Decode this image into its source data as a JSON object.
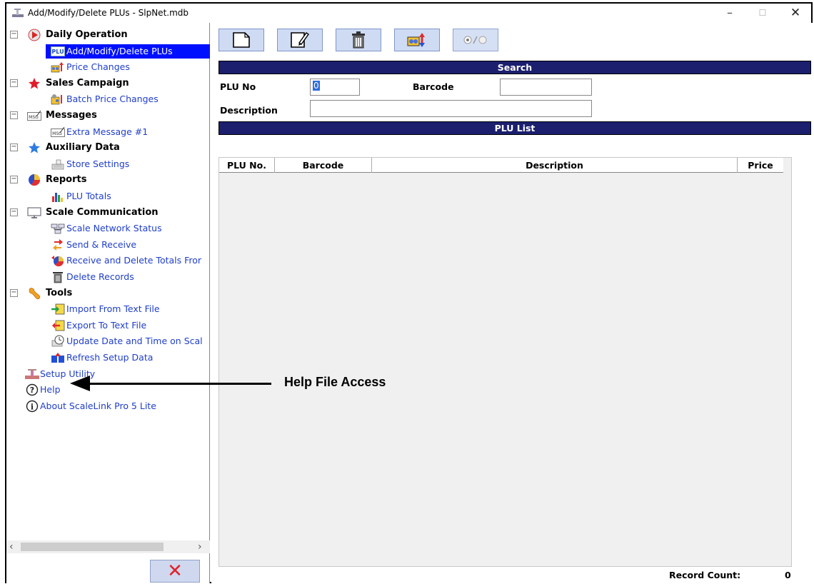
{
  "window": {
    "title": "Add/Modify/Delete PLUs - SlpNet.mdb",
    "min": "–",
    "max": "☐",
    "close": "✕"
  },
  "tree": [
    {
      "kind": "cat",
      "label": "Daily Operation",
      "icon": "play-circle-icon"
    },
    {
      "kind": "item",
      "label": "Add/Modify/Delete PLUs",
      "icon": "plu-icon",
      "selected": true
    },
    {
      "kind": "item",
      "label": "Price Changes",
      "icon": "price-change-icon"
    },
    {
      "kind": "cat",
      "label": "Sales Campaign",
      "icon": "star-red-icon"
    },
    {
      "kind": "item",
      "label": "Batch Price Changes",
      "icon": "batch-price-icon"
    },
    {
      "kind": "cat",
      "label": "Messages",
      "icon": "message-icon"
    },
    {
      "kind": "item",
      "label": "Extra Message #1",
      "icon": "message-icon"
    },
    {
      "kind": "cat",
      "label": "Auxiliary Data",
      "icon": "star-blue-icon"
    },
    {
      "kind": "item",
      "label": "Store Settings",
      "icon": "store-settings-icon"
    },
    {
      "kind": "cat",
      "label": "Reports",
      "icon": "pie-chart-icon"
    },
    {
      "kind": "item",
      "label": "PLU Totals",
      "icon": "bar-chart-icon"
    },
    {
      "kind": "cat",
      "label": "Scale Communication",
      "icon": "monitor-icon"
    },
    {
      "kind": "item",
      "label": "Scale Network Status",
      "icon": "network-icon"
    },
    {
      "kind": "item",
      "label": "Send & Receive",
      "icon": "send-receive-icon"
    },
    {
      "kind": "item",
      "label": "Receive and Delete Totals Fror",
      "icon": "pie-receive-icon"
    },
    {
      "kind": "item",
      "label": "Delete Records",
      "icon": "trash-icon"
    },
    {
      "kind": "cat",
      "label": "Tools",
      "icon": "wrench-icon"
    },
    {
      "kind": "item",
      "label": "Import From Text File",
      "icon": "import-icon"
    },
    {
      "kind": "item",
      "label": "Export To Text File",
      "icon": "export-icon"
    },
    {
      "kind": "item",
      "label": "Update Date and Time on Scal",
      "icon": "clock-icon"
    },
    {
      "kind": "item",
      "label": "Refresh Setup Data",
      "icon": "refresh-icon"
    },
    {
      "kind": "root",
      "label": "Setup Utility",
      "icon": "setup-icon"
    },
    {
      "kind": "root",
      "label": "Help",
      "icon": "help-icon"
    },
    {
      "kind": "root",
      "label": "About ScaleLink Pro 5 Lite",
      "icon": "info-icon"
    }
  ],
  "search": {
    "header": "Search",
    "plu_label": "PLU No",
    "plu_value": "0",
    "barcode_label": "Barcode",
    "barcode_value": "",
    "description_label": "Description",
    "description_value": ""
  },
  "plu_list": {
    "header": "PLU List",
    "columns": [
      "PLU No.",
      "Barcode",
      "Description",
      "Price"
    ],
    "rows": []
  },
  "footer": {
    "record_count_label": "Record Count:",
    "record_count": "0"
  },
  "annotation": {
    "text": "Help File Access"
  },
  "colors": {
    "selection": "#0010ff",
    "bar": "#1b1f6e",
    "link": "#1f3ec9"
  }
}
